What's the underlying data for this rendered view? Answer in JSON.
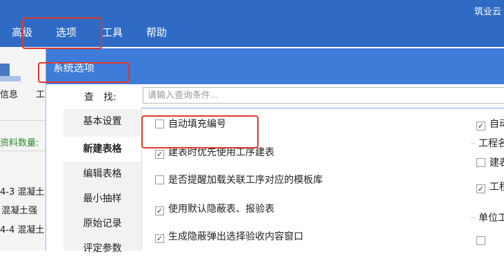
{
  "app": {
    "title": "筑业云"
  },
  "menu": {
    "items": [
      "高级",
      "选项",
      "工具",
      "帮助"
    ]
  },
  "left_panel": {
    "info_label": "信息",
    "tool_label": "工",
    "count_label": "资料数量:",
    "rows": [
      "4-3 混凝土",
      "混凝土强",
      "4-4 混凝土"
    ]
  },
  "dialog": {
    "title": "系统选项",
    "search": {
      "label": "查　找:",
      "placeholder": "请输入查询条件..."
    },
    "nav": [
      "基本设置",
      "新建表格",
      "编辑表格",
      "最小抽样",
      "原始记录",
      "评定参数"
    ],
    "active_nav": "新建表格",
    "options": [
      {
        "label": "自动填充编号",
        "checked": false
      },
      {
        "label": "建表时优先使用工序建表",
        "checked": true
      },
      {
        "label": "是否提醒加载关联工序对应的模板库",
        "checked": false
      },
      {
        "label": "使用默认隐蔽表、报验表",
        "checked": true
      },
      {
        "label": "生成隐蔽弹出选择验收内容窗口",
        "checked": true
      }
    ],
    "right_column": {
      "top_option": {
        "label": "自动",
        "checked": true
      },
      "group1": {
        "title": "工程名",
        "items": [
          {
            "label": "建表",
            "checked": false
          },
          {
            "label": "工程",
            "checked": true
          }
        ]
      },
      "group2": {
        "title": "单位工"
      }
    }
  },
  "colors": {
    "topbar": "#2f6bc4",
    "dialog_title": "#3f7bd8",
    "annotation": "#e0392b"
  }
}
